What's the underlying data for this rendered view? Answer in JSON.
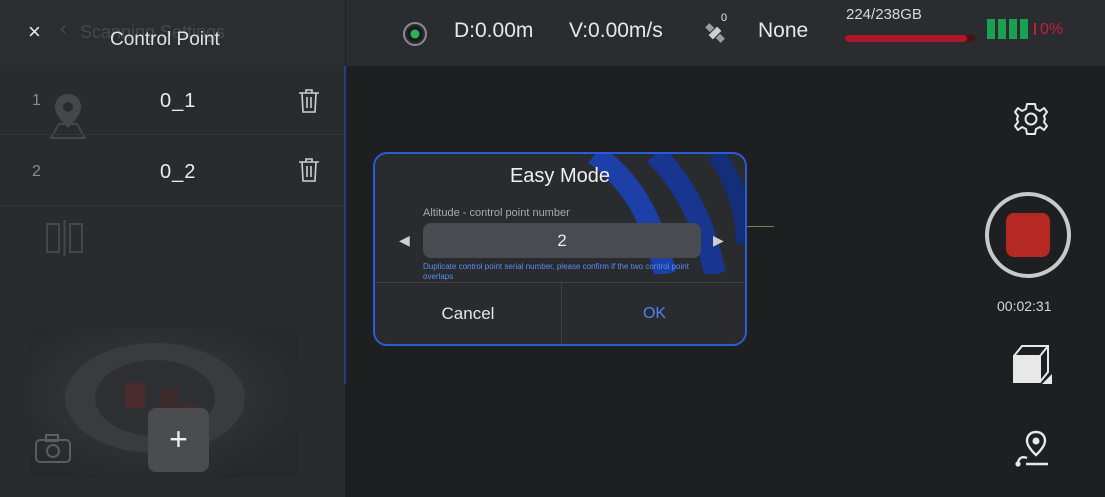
{
  "panel": {
    "close_glyph": "×",
    "ghost_title": "Scanning Settings",
    "title": "Control Point",
    "rows": [
      {
        "num": "1",
        "name": "0_1"
      },
      {
        "num": "2",
        "name": "0_2"
      }
    ],
    "add_glyph": "+"
  },
  "status": {
    "distance": "D:0.00m",
    "velocity": "V:0.00m/s",
    "gps_sat_count": "0",
    "rtk": "None",
    "storage": "224/238GB",
    "storage_used_fraction": 0.94,
    "battery_pct": "0%",
    "colors": {
      "storage": "#b0162a",
      "battery": "#1aa051",
      "battery_pct": "#c0203a"
    }
  },
  "record": {
    "time": "00:02:31",
    "color": "#b62822"
  },
  "icons": [
    "close-icon",
    "back-chevron-icon",
    "trash-icon",
    "location-pin-icon",
    "split-icon",
    "camera-icon",
    "gps-icon",
    "satellite-icon",
    "settings-gear-icon",
    "record-stop-icon",
    "cube-icon",
    "route-pin-icon",
    "arrow-left-icon",
    "arrow-right-icon"
  ],
  "dialog": {
    "title": "Easy Mode",
    "field_label": "Altitude - control point number",
    "value": "2",
    "warning": "Duplicate control point serial number, please confirm if the two control point overlaps",
    "cancel": "Cancel",
    "ok": "OK",
    "accent": "#2a5cd6"
  }
}
